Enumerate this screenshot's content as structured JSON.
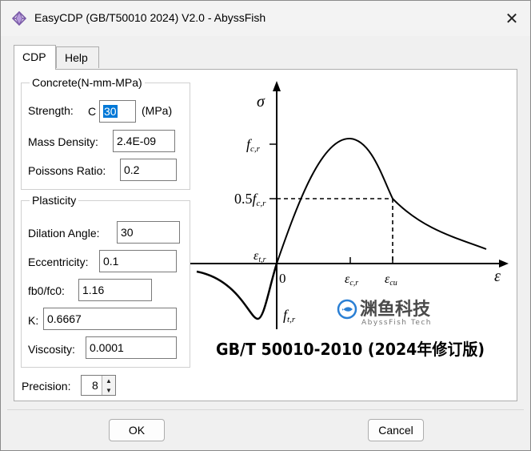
{
  "window": {
    "title": "EasyCDP (GB/T50010 2024) V2.0 - AbyssFish",
    "close_glyph": "✕"
  },
  "tabs": [
    {
      "label": "CDP"
    },
    {
      "label": "Help"
    }
  ],
  "concrete": {
    "legend": "Concrete(N-mm-MPa)",
    "strength_label": "Strength:",
    "strength_prefix": "C",
    "strength_value": "30",
    "strength_unit": "(MPa)",
    "density_label": "Mass Density:",
    "density_value": "2.4E-09",
    "poisson_label": "Poissons Ratio:",
    "poisson_value": "0.2"
  },
  "plasticity": {
    "legend": "Plasticity",
    "dilation_label": "Dilation Angle:",
    "dilation_value": "30",
    "eccentricity_label": "Eccentricity:",
    "eccentricity_value": "0.1",
    "fb0_label": "fb0/fc0:",
    "fb0_value": "1.16",
    "k_label": "K:",
    "k_value": "0.6667",
    "viscosity_label": "Viscosity:",
    "viscosity_value": "0.0001"
  },
  "precision": {
    "label": "Precision:",
    "value": "8"
  },
  "diagram": {
    "sigma": "σ",
    "epsilon": "ε",
    "fc": "f",
    "fc_sub": "c,r",
    "half": "0.5",
    "eps_tr": "ε",
    "eps_tr_sub": "t,r",
    "zero": "0",
    "eps_c": "ε",
    "eps_c_sub": "c,r",
    "eps_cu": "ε",
    "eps_cu_sub": "cu",
    "ft": "f",
    "ft_sub": "t,r",
    "logo_cn": "渊鱼科技",
    "logo_en": "AbyssFish Tech",
    "caption": "GB/T 50010-2010 (2024年修订版)",
    "colors": {
      "logo_blue": "#2a7fd4",
      "logo_grey": "#4a4a4a"
    }
  },
  "buttons": {
    "ok": "OK",
    "cancel": "Cancel"
  }
}
